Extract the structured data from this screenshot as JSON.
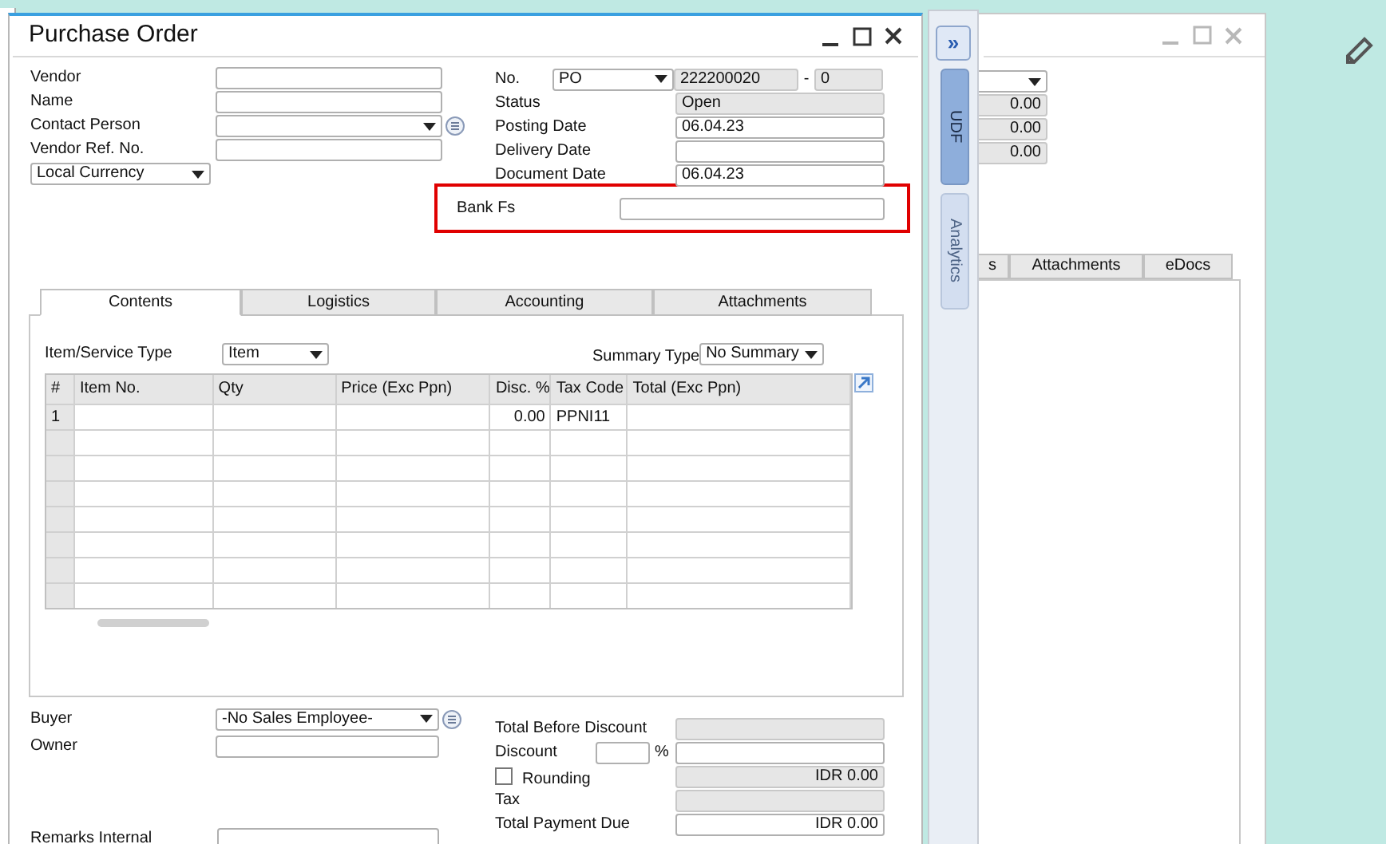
{
  "window": {
    "title": "Purchase Order"
  },
  "header_left": [
    {
      "kind": "field",
      "label": "Vendor"
    },
    {
      "kind": "field",
      "label": "Name"
    },
    {
      "kind": "select",
      "label": "Contact Person",
      "lookup": true
    },
    {
      "kind": "field",
      "label": "Vendor Ref. No."
    }
  ],
  "currency_select": {
    "value": "Local Currency"
  },
  "header_right": {
    "number_row": {
      "label": "No.",
      "series": "PO",
      "number": "222200020",
      "separator": "-",
      "suffix": "0"
    },
    "rows": [
      {
        "kind": "readonly",
        "label": "Status",
        "value": "Open"
      },
      {
        "kind": "field",
        "label": "Posting Date",
        "value": "06.04.23"
      },
      {
        "kind": "field",
        "label": "Delivery Date"
      },
      {
        "kind": "field",
        "label": "Document Date",
        "value": "06.04.23"
      }
    ]
  },
  "bank_fs": {
    "label": "Bank Fs",
    "highlighted": true
  },
  "tabs": [
    {
      "label": "Contents",
      "selected": true
    },
    {
      "label": "Logistics",
      "selected": false
    },
    {
      "label": "Accounting",
      "selected": false
    },
    {
      "label": "Attachments",
      "selected": false
    }
  ],
  "item_type": {
    "label": "Item/Service Type",
    "value": "Item"
  },
  "summary_type": {
    "label": "Summary Type",
    "value": "No Summary"
  },
  "table": {
    "columns": [
      "#",
      "Item No.",
      "Qty",
      "Price (Exc Ppn)",
      "Disc. %",
      "Tax Code",
      "Total (Exc Ppn)"
    ],
    "rows": [
      {
        "cells": [
          "1",
          null,
          null,
          null,
          "0.00",
          "PPNI11",
          null
        ]
      }
    ]
  },
  "footer_left": [
    {
      "kind": "select",
      "label": "Buyer",
      "value": "-No Sales Employee-",
      "lookup": true
    },
    {
      "kind": "field",
      "label": "Owner"
    }
  ],
  "remarks": {
    "label": "Remarks Internal"
  },
  "totals": [
    {
      "kind": "readonly",
      "label": "Total Before Discount"
    },
    {
      "kind": "percent",
      "label": "Discount",
      "unit": "%"
    },
    {
      "kind": "checkbox",
      "label": "Rounding",
      "checked": false,
      "value": "IDR 0.00"
    },
    {
      "kind": "readonly",
      "label": "Tax"
    },
    {
      "kind": "field",
      "label": "Total Payment Due",
      "value": "IDR 0.00"
    }
  ],
  "side_panel": {
    "expand": "»",
    "tabs": [
      {
        "label": "UDF",
        "disabled": false
      },
      {
        "label": "Analytics",
        "disabled": true
      }
    ]
  },
  "back_window": {
    "values": [
      "0.00",
      "0.00",
      "0.00"
    ],
    "tabs": [
      {
        "label": "s"
      },
      {
        "label": "Attachments"
      },
      {
        "label": "eDocs"
      }
    ]
  }
}
